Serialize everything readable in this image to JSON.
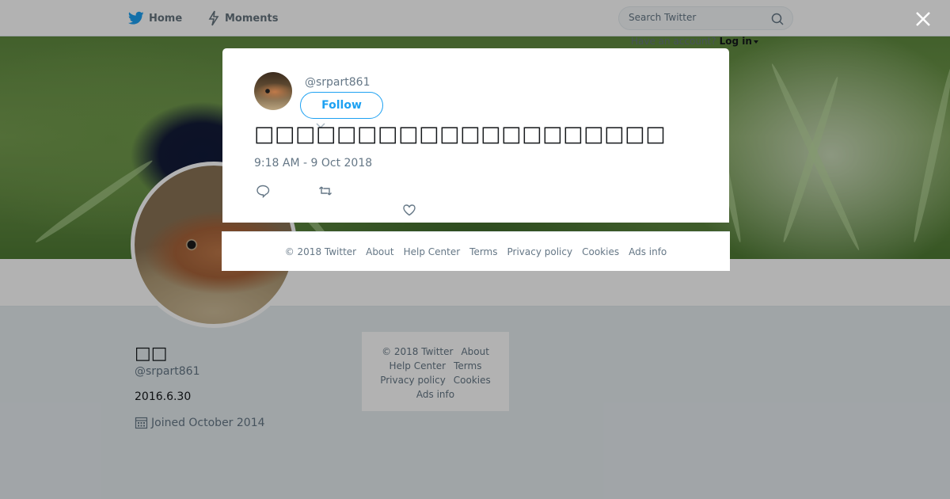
{
  "nav": {
    "home_label": "Home",
    "moments_label": "Moments",
    "search_placeholder": "Search Twitter",
    "have_account": "Have an account?",
    "login_label": "Log in"
  },
  "profile": {
    "name": "□□",
    "handle": "@srpart861",
    "bio": "2016.6.30",
    "joined": "Joined October 2014"
  },
  "side_footer": {
    "copyright": "© 2018 Twitter",
    "about": "About",
    "help": "Help Center",
    "terms": "Terms",
    "privacy": "Privacy policy",
    "cookies": "Cookies",
    "ads": "Ads info"
  },
  "tweet": {
    "handle": "@srpart861",
    "follow_label": "Follow",
    "text": "□□□□□□□□□□□□□□□□□□□□",
    "timestamp": "9:18 AM - 9 Oct 2018"
  },
  "modal_footer": {
    "copyright": "© 2018 Twitter",
    "about": "About",
    "help": "Help Center",
    "terms": "Terms",
    "privacy": "Privacy policy",
    "cookies": "Cookies",
    "ads": "Ads info"
  },
  "colors": {
    "brand": "#1da1f2",
    "text": "#14171a",
    "muted": "#657786"
  },
  "icons": [
    "twitter-bird-icon",
    "lightning-icon",
    "search-icon",
    "close-icon",
    "reply-icon",
    "retweet-icon",
    "heart-icon",
    "calendar-icon",
    "chevron-down-icon"
  ]
}
